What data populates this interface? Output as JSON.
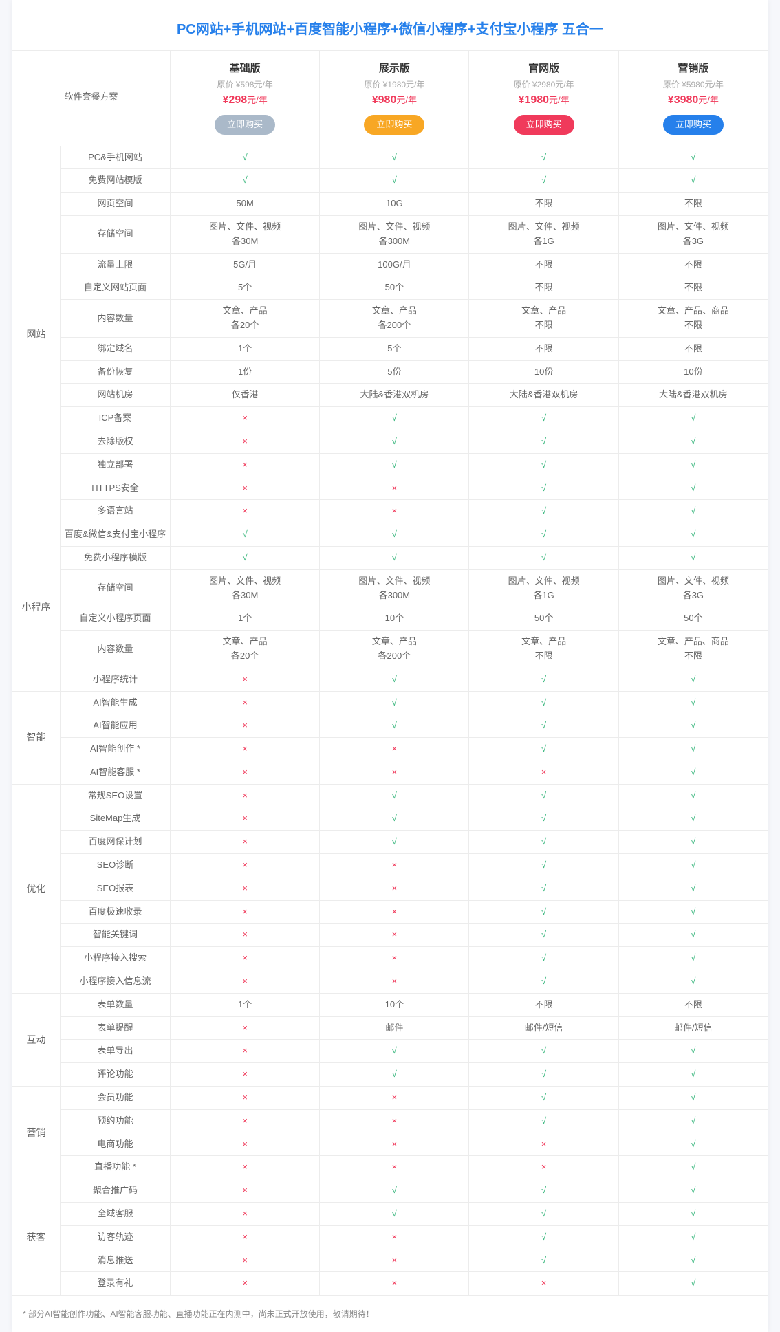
{
  "title": "PC网站+手机网站+百度智能小程序+微信小程序+支付宝小程序 五合一",
  "corner_label": "软件套餐方案",
  "plans": [
    {
      "name": "基础版",
      "old": "原价 ¥598元/年",
      "now_amt": "¥298",
      "now_suf": "元/年",
      "btn": "立即购买"
    },
    {
      "name": "展示版",
      "old": "原价 ¥1980元/年",
      "now_amt": "¥980",
      "now_suf": "元/年",
      "btn": "立即购买"
    },
    {
      "name": "官网版",
      "old": "原价 ¥2980元/年",
      "now_amt": "¥1980",
      "now_suf": "元/年",
      "btn": "立即购买"
    },
    {
      "name": "营销版",
      "old": "原价 ¥5980元/年",
      "now_amt": "¥3980",
      "now_suf": "元/年",
      "btn": "立即购买"
    }
  ],
  "groups": [
    {
      "cat": "网站",
      "rows": [
        {
          "label": "PC&手机网站",
          "v": [
            "√",
            "√",
            "√",
            "√"
          ]
        },
        {
          "label": "免费网站模版",
          "v": [
            "√",
            "√",
            "√",
            "√"
          ]
        },
        {
          "label": "网页空间",
          "v": [
            "50M",
            "10G",
            "不限",
            "不限"
          ]
        },
        {
          "label": "存储空间",
          "v": [
            "图片、文件、视频\n各30M",
            "图片、文件、视频\n各300M",
            "图片、文件、视频\n各1G",
            "图片、文件、视频\n各3G"
          ]
        },
        {
          "label": "流量上限",
          "v": [
            "5G/月",
            "100G/月",
            "不限",
            "不限"
          ]
        },
        {
          "label": "自定义网站页面",
          "v": [
            "5个",
            "50个",
            "不限",
            "不限"
          ]
        },
        {
          "label": "内容数量",
          "v": [
            "文章、产品\n各20个",
            "文章、产品\n各200个",
            "文章、产品\n不限",
            "文章、产品、商品\n不限"
          ]
        },
        {
          "label": "绑定域名",
          "v": [
            "1个",
            "5个",
            "不限",
            "不限"
          ]
        },
        {
          "label": "备份恢复",
          "v": [
            "1份",
            "5份",
            "10份",
            "10份"
          ]
        },
        {
          "label": "网站机房",
          "v": [
            "仅香港",
            "大陆&香港双机房",
            "大陆&香港双机房",
            "大陆&香港双机房"
          ]
        },
        {
          "label": "ICP备案",
          "v": [
            "×",
            "√",
            "√",
            "√"
          ]
        },
        {
          "label": "去除版权",
          "v": [
            "×",
            "√",
            "√",
            "√"
          ]
        },
        {
          "label": "独立部署",
          "v": [
            "×",
            "√",
            "√",
            "√"
          ]
        },
        {
          "label": "HTTPS安全",
          "v": [
            "×",
            "×",
            "√",
            "√"
          ]
        },
        {
          "label": "多语言站",
          "v": [
            "×",
            "×",
            "√",
            "√"
          ]
        }
      ]
    },
    {
      "cat": "小程序",
      "rows": [
        {
          "label": "百度&微信&支付宝小程序",
          "v": [
            "√",
            "√",
            "√",
            "√"
          ]
        },
        {
          "label": "免费小程序模版",
          "v": [
            "√",
            "√",
            "√",
            "√"
          ]
        },
        {
          "label": "存储空间",
          "v": [
            "图片、文件、视频\n各30M",
            "图片、文件、视频\n各300M",
            "图片、文件、视频\n各1G",
            "图片、文件、视频\n各3G"
          ]
        },
        {
          "label": "自定义小程序页面",
          "v": [
            "1个",
            "10个",
            "50个",
            "50个"
          ]
        },
        {
          "label": "内容数量",
          "v": [
            "文章、产品\n各20个",
            "文章、产品\n各200个",
            "文章、产品\n不限",
            "文章、产品、商品\n不限"
          ]
        },
        {
          "label": "小程序统计",
          "v": [
            "×",
            "√",
            "√",
            "√"
          ]
        }
      ]
    },
    {
      "cat": "智能",
      "rows": [
        {
          "label": "AI智能生成",
          "v": [
            "×",
            "√",
            "√",
            "√"
          ]
        },
        {
          "label": "AI智能应用",
          "v": [
            "×",
            "√",
            "√",
            "√"
          ]
        },
        {
          "label": "AI智能创作 *",
          "v": [
            "×",
            "×",
            "√",
            "√"
          ]
        },
        {
          "label": "AI智能客服 *",
          "v": [
            "×",
            "×",
            "×",
            "√"
          ]
        }
      ]
    },
    {
      "cat": "优化",
      "rows": [
        {
          "label": "常规SEO设置",
          "v": [
            "×",
            "√",
            "√",
            "√"
          ]
        },
        {
          "label": "SiteMap生成",
          "v": [
            "×",
            "√",
            "√",
            "√"
          ]
        },
        {
          "label": "百度网保计划",
          "v": [
            "×",
            "√",
            "√",
            "√"
          ]
        },
        {
          "label": "SEO诊断",
          "v": [
            "×",
            "×",
            "√",
            "√"
          ]
        },
        {
          "label": "SEO报表",
          "v": [
            "×",
            "×",
            "√",
            "√"
          ]
        },
        {
          "label": "百度极速收录",
          "v": [
            "×",
            "×",
            "√",
            "√"
          ]
        },
        {
          "label": "智能关键词",
          "v": [
            "×",
            "×",
            "√",
            "√"
          ]
        },
        {
          "label": "小程序接入搜索",
          "v": [
            "×",
            "×",
            "√",
            "√"
          ]
        },
        {
          "label": "小程序接入信息流",
          "v": [
            "×",
            "×",
            "√",
            "√"
          ]
        }
      ]
    },
    {
      "cat": "互动",
      "rows": [
        {
          "label": "表单数量",
          "v": [
            "1个",
            "10个",
            "不限",
            "不限"
          ]
        },
        {
          "label": "表单提醒",
          "v": [
            "×",
            "邮件",
            "邮件/短信",
            "邮件/短信"
          ]
        },
        {
          "label": "表单导出",
          "v": [
            "×",
            "√",
            "√",
            "√"
          ]
        },
        {
          "label": "评论功能",
          "v": [
            "×",
            "√",
            "√",
            "√"
          ]
        }
      ]
    },
    {
      "cat": "营销",
      "rows": [
        {
          "label": "会员功能",
          "v": [
            "×",
            "×",
            "√",
            "√"
          ]
        },
        {
          "label": "预约功能",
          "v": [
            "×",
            "×",
            "√",
            "√"
          ]
        },
        {
          "label": "电商功能",
          "v": [
            "×",
            "×",
            "×",
            "√"
          ]
        },
        {
          "label": "直播功能 *",
          "v": [
            "×",
            "×",
            "×",
            "√"
          ]
        }
      ]
    },
    {
      "cat": "获客",
      "rows": [
        {
          "label": "聚合推广码",
          "v": [
            "×",
            "√",
            "√",
            "√"
          ]
        },
        {
          "label": "全域客服",
          "v": [
            "×",
            "√",
            "√",
            "√"
          ]
        },
        {
          "label": "访客轨迹",
          "v": [
            "×",
            "×",
            "√",
            "√"
          ]
        },
        {
          "label": "消息推送",
          "v": [
            "×",
            "×",
            "√",
            "√"
          ]
        },
        {
          "label": "登录有礼",
          "v": [
            "×",
            "×",
            "×",
            "√"
          ]
        }
      ]
    }
  ],
  "footnote": "* 部分AI智能创作功能、AI智能客服功能、直播功能正在内测中，尚未正式开放使用，敬请期待！"
}
